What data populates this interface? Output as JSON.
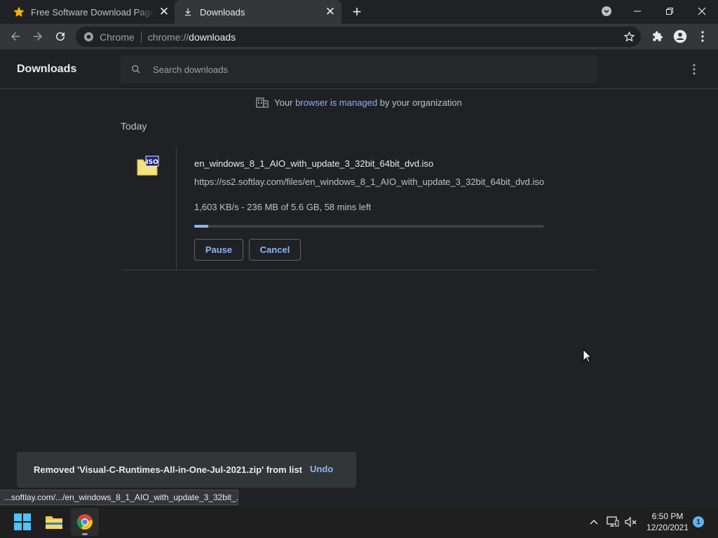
{
  "window": {
    "tabs": [
      {
        "title": "Free Software Download Page - Softlay",
        "favicon": "star-icon"
      },
      {
        "title": "Downloads",
        "favicon": "download-icon"
      }
    ],
    "active_tab": 1
  },
  "toolbar": {
    "omnibox_chip": "Chrome",
    "url_scheme": "chrome://",
    "url_host": "downloads"
  },
  "header": {
    "title": "Downloads",
    "search_placeholder": "Search downloads"
  },
  "managed": {
    "prefix": "Your",
    "link": "browser is managed",
    "suffix": "by your organization"
  },
  "section": {
    "title": "Today"
  },
  "download": {
    "file_type_label": "ISO",
    "filename": "en_windows_8_1_AIO_with_update_3_32bit_64bit_dvd.iso",
    "url": "https://ss2.softlay.com/files/en_windows_8_1_AIO_with_update_3_32bit_64bit_dvd.iso",
    "status": "1,603 KB/s - 236 MB of 5.6 GB, 58 mins left",
    "progress_fraction": 0.04,
    "pause_label": "Pause",
    "cancel_label": "Cancel"
  },
  "toast": {
    "message": "Removed 'Visual-C-Runtimes-All-in-One-Jul-2021.zip' from list",
    "undo_label": "Undo"
  },
  "status_bubble": {
    "text": "...softlay.com/.../en_windows_8_1_AIO_with_update_3_32bit_..."
  },
  "taskbar": {
    "apps": [
      "windows-start",
      "file-explorer",
      "chrome"
    ],
    "clock_time": "6:50 PM",
    "clock_date": "12/20/2021",
    "notification_count": "1"
  },
  "colors": {
    "accent": "#8ab4f8",
    "background": "#202124",
    "toolbar": "#35363a"
  }
}
